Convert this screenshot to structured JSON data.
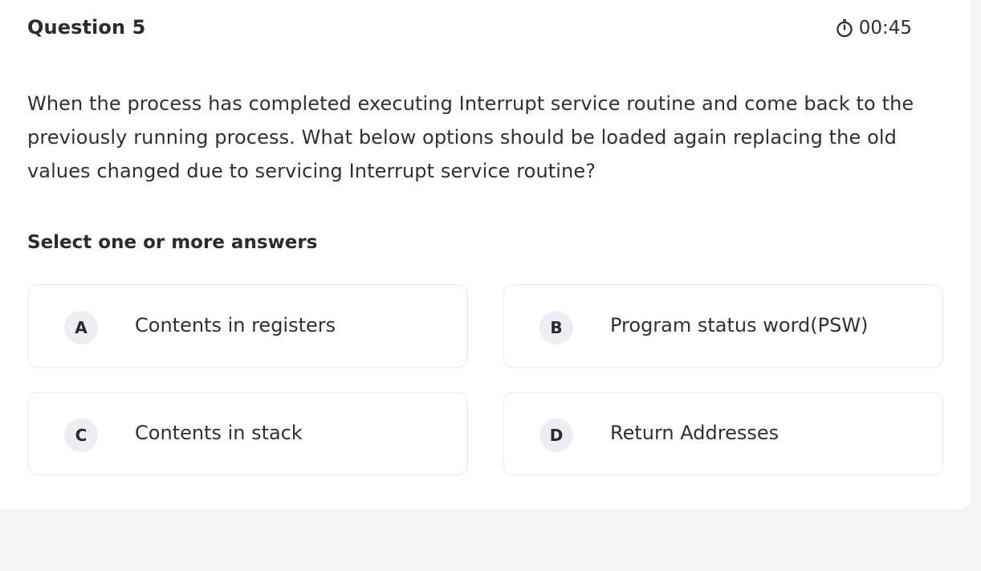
{
  "question": {
    "title": "Question 5",
    "text": "When the process has completed executing Interrupt service routine and come back to the previously running process. What below options should be loaded again replacing the old values changed due to servicing Interrupt service routine?",
    "instruction": "Select one or more answers"
  },
  "timer": {
    "value": "00:45",
    "icon": "stopwatch-icon"
  },
  "options": [
    {
      "letter": "A",
      "label": "Contents in registers"
    },
    {
      "letter": "B",
      "label": "Program status word(PSW)"
    },
    {
      "letter": "C",
      "label": "Contents in stack"
    },
    {
      "letter": "D",
      "label": "Return Addresses"
    }
  ],
  "colors": {
    "page_background": "#f4f5f7",
    "card_background": "#ffffff",
    "badge_background": "#eceef3",
    "text": "#2f3037",
    "option_border": "#e9eaee"
  }
}
